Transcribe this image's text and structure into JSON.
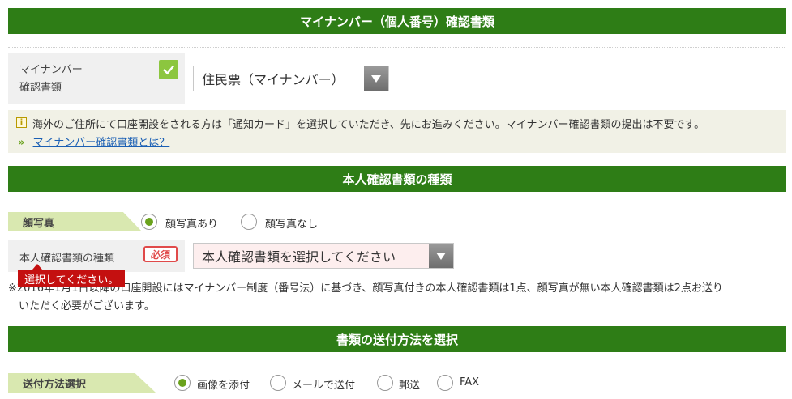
{
  "mynumber_section": {
    "title": "マイナンバー（個人番号）確認書類",
    "field_label_line1": "マイナンバー",
    "field_label_line2": "確認書類",
    "selected_document": "住民票（マイナンバー）",
    "notice_text": "海外のご住所にて口座開設をされる方は「通知カード」を選択していただき、先にお進みください。マイナンバー確認書類の提出は不要です。",
    "link_text": "マイナンバー確認書類とは？",
    "link_prefix": "»"
  },
  "id_section": {
    "title": "本人確認書類の種類",
    "photo_label": "顔写真",
    "photo_options": [
      "顔写真あり",
      "顔写真なし"
    ],
    "photo_selected": "顔写真あり",
    "type_label": "本人確認書類の種類",
    "required_badge": "必須",
    "type_placeholder": "本人確認書類を選択してください",
    "error_tooltip": "選択してください。",
    "note_line1": "※2016年1月1日以降の口座開設にはマイナンバー制度（番号法）に基づき、顔写真付きの本人確認書類は1点、顔写真が無い本人確認書類は2点お送り",
    "note_line2": "いただく必要がございます。"
  },
  "send_section": {
    "title": "書類の送付方法を選択",
    "method_label": "送付方法選択",
    "options": [
      "画像を添付",
      "メールで送付",
      "郵送",
      "FAX"
    ],
    "selected": "画像を添付"
  },
  "colors": {
    "header_green": "#2e7d16",
    "radio_green": "#6aa21c",
    "error_red": "#c41010"
  }
}
